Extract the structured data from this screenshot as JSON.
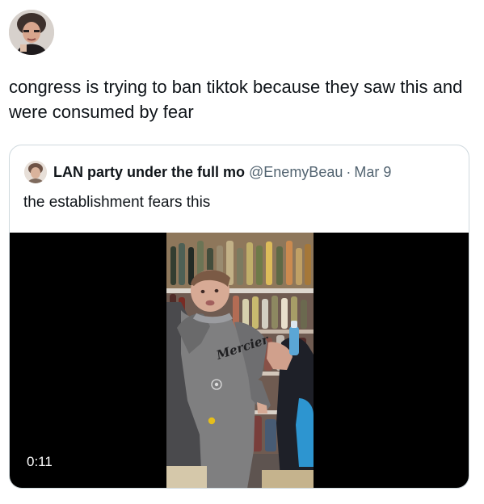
{
  "post": {
    "text": "congress is trying to ban tiktok because they saw this and were consumed by fear"
  },
  "quote": {
    "display_name": "LAN party under the full mo",
    "handle": "@EnemyBeau",
    "separator": "·",
    "date": "Mar 9",
    "text": "the establishment fears this",
    "video": {
      "duration": "0:11",
      "shirt_text": "Mercier"
    }
  },
  "colors": {
    "text_primary": "#0f1419",
    "text_secondary": "#536471",
    "border": "#cfd9de",
    "media_background": "#000000"
  },
  "icons": {
    "author_avatar": "profile-photo",
    "quoted_avatar": "profile-photo"
  }
}
